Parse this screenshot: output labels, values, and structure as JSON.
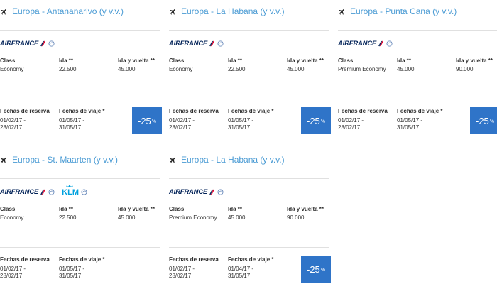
{
  "offers": [
    {
      "route": "Europa - Antananarivo (y v.v.)",
      "icon": "airplane-icon",
      "airlines": [
        "AIRFRANCE"
      ],
      "fares_header": {
        "class": "Class",
        "ida": "Ida **",
        "ida_vuelta": "Ida y vuelta **"
      },
      "fares": {
        "class": "Economy",
        "ida": "22.500",
        "ida_vuelta": "45.000"
      },
      "dates_header": {
        "reserva": "Fechas de reserva",
        "viaje": "Fechas de viaje *"
      },
      "reserva": {
        "from": "01/02/17 -",
        "to": "28/02/17"
      },
      "viaje": {
        "from": "01/05/17 -",
        "to": "31/05/17"
      },
      "discount": {
        "value": "-25",
        "unit": "%"
      }
    },
    {
      "route": "Europa - La Habana (y v.v.)",
      "icon": "airplane-icon",
      "airlines": [
        "AIRFRANCE"
      ],
      "fares_header": {
        "class": "Class",
        "ida": "Ida **",
        "ida_vuelta": "Ida y vuelta **"
      },
      "fares": {
        "class": "Economy",
        "ida": "22.500",
        "ida_vuelta": "45.000"
      },
      "dates_header": {
        "reserva": "Fechas de reserva",
        "viaje": "Fechas de viaje *"
      },
      "reserva": {
        "from": "01/02/17 -",
        "to": "28/02/17"
      },
      "viaje": {
        "from": "01/05/17 -",
        "to": "31/05/17"
      },
      "discount": {
        "value": "-25",
        "unit": "%"
      }
    },
    {
      "route": "Europa - Punta Cana (y v.v.)",
      "icon": "airplane-icon",
      "airlines": [
        "AIRFRANCE"
      ],
      "fares_header": {
        "class": "Class",
        "ida": "Ida **",
        "ida_vuelta": "Ida y vuelta **"
      },
      "fares": {
        "class": "Premium Economy",
        "ida": "45.000",
        "ida_vuelta": "90.000"
      },
      "dates_header": {
        "reserva": "Fechas de reserva",
        "viaje": "Fechas de viaje *"
      },
      "reserva": {
        "from": "01/02/17 -",
        "to": "28/02/17"
      },
      "viaje": {
        "from": "01/05/17 -",
        "to": "31/05/17"
      },
      "discount": {
        "value": "-25",
        "unit": "%"
      }
    },
    {
      "route": "Europa - St. Maarten (y v.v.)",
      "icon": "airplane-icon",
      "airlines": [
        "AIRFRANCE",
        "KLM"
      ],
      "fares_header": {
        "class": "Class",
        "ida": "Ida **",
        "ida_vuelta": "Ida y vuelta **"
      },
      "fares": {
        "class": "Economy",
        "ida": "22.500",
        "ida_vuelta": "45.000"
      },
      "dates_header": {
        "reserva": "Fechas de reserva",
        "viaje": "Fechas de viaje *"
      },
      "reserva": {
        "from": "01/02/17 -",
        "to": "28/02/17"
      },
      "viaje": {
        "from": "01/05/17 -",
        "to": "31/05/17"
      }
    },
    {
      "route": "Europa - La Habana (y v.v.)",
      "icon": "airplane-icon",
      "airlines": [
        "AIRFRANCE"
      ],
      "fares_header": {
        "class": "Class",
        "ida": "Ida **",
        "ida_vuelta": "Ida y vuelta **"
      },
      "fares": {
        "class": "Premium Economy",
        "ida": "45.000",
        "ida_vuelta": "90.000"
      },
      "dates_header": {
        "reserva": "Fechas de reserva",
        "viaje": "Fechas de viaje *"
      },
      "reserva": {
        "from": "01/02/17 -",
        "to": "28/02/17"
      },
      "viaje": {
        "from": "01/04/17 -",
        "to": "31/05/17"
      },
      "discount": {
        "value": "-25",
        "unit": "%"
      }
    }
  ],
  "colors": {
    "route_link": "#4a9bd4",
    "badge": "#2f74c8",
    "airfrance": "#002157",
    "klm": "#00a1de"
  }
}
